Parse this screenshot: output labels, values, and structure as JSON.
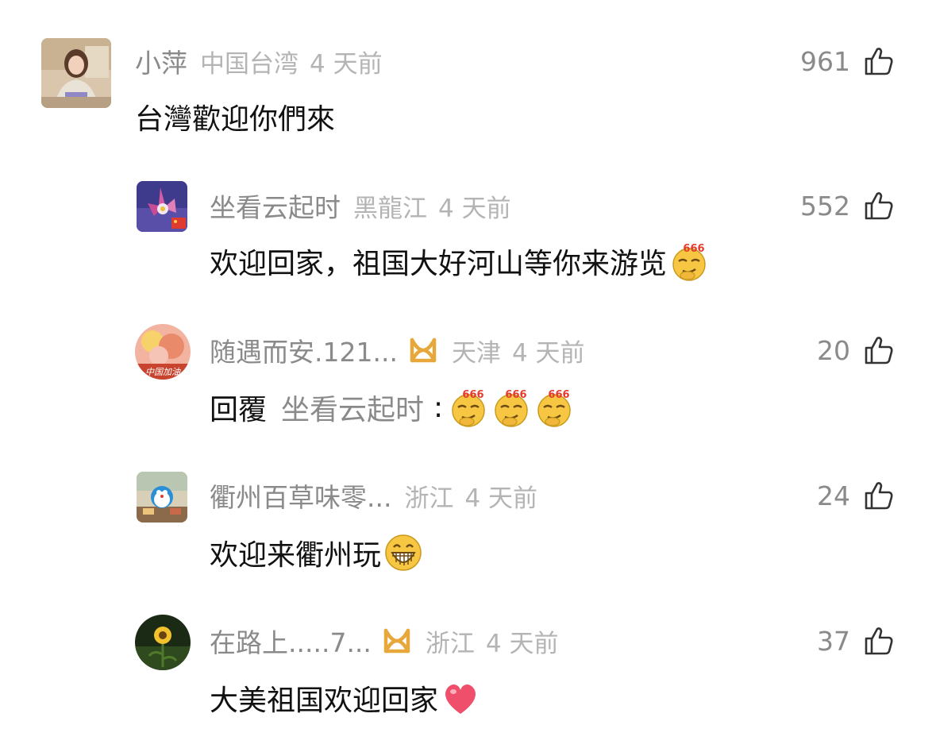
{
  "comments": [
    {
      "username": "小萍",
      "location": "中国台湾",
      "time": "4 天前",
      "likes": "961",
      "text": "台灣歡迎你們來",
      "avatar": "avatar-photo-woman"
    },
    {
      "username": "坐看云起时",
      "location": "黑龍江",
      "time": "4 天前",
      "likes": "552",
      "text": "欢迎回家，祖国大好河山等你来游览",
      "avatar": "avatar-flower-flag",
      "emojis": [
        "emoji-666-icon"
      ]
    },
    {
      "username": "随遇而安.121...",
      "location": "天津",
      "time": "4 天前",
      "likes": "20",
      "reply_keyword": "回覆",
      "reply_target": "坐看云起时",
      "reply_colon": ":",
      "avatar": "avatar-flowers-zhongguojiayou",
      "avatar_caption": "中国加油",
      "badge_icon": "vip-ribbon-icon",
      "emojis": [
        "emoji-666-icon",
        "emoji-666-icon",
        "emoji-666-icon"
      ]
    },
    {
      "username": "衢州百草味零...",
      "location": "浙江",
      "time": "4 天前",
      "likes": "24",
      "text": "欢迎来衢州玩",
      "avatar": "avatar-doraemon",
      "emojis": [
        "emoji-grin-icon"
      ]
    },
    {
      "username": "在路上.....7...",
      "location": "浙江",
      "time": "4 天前",
      "likes": "37",
      "text": "大美祖国欢迎回家",
      "avatar": "avatar-sunflower",
      "badge_icon": "vip-ribbon-icon",
      "emojis": [
        "heart-emoji-icon"
      ]
    }
  ],
  "colors": {
    "username": "#8a8a8a",
    "meta": "#b4b4b4",
    "text": "#111111",
    "badge": "#e8a73a"
  }
}
